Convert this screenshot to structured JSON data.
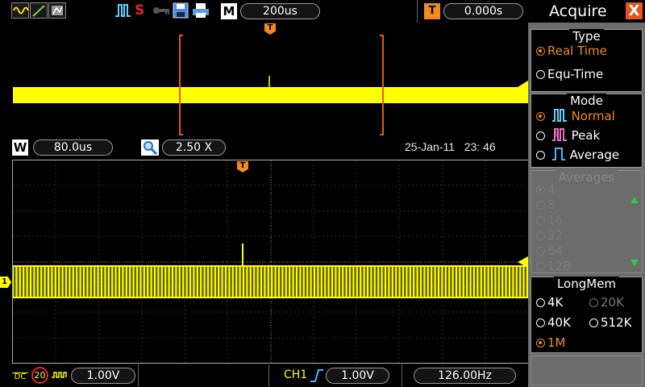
{
  "topbar": {
    "timebase": "200us",
    "trigger_offset": "0.000s",
    "mode_letter": "M",
    "trigger_letter": "T"
  },
  "info": {
    "window_letter": "W",
    "window_scale": "80.0us",
    "zoom_value": "2.50  X",
    "date": "25-Jan-11",
    "time": "23: 46"
  },
  "bottom": {
    "coupling": "DC",
    "bw_limit": "20",
    "ch_scale": "1.00V",
    "trig_source": "CH1",
    "trig_level": "1.00V",
    "frequency": "126.00Hz"
  },
  "channel_marker": "1",
  "marker_T": "T",
  "panel": {
    "title": "Acquire",
    "close": "X",
    "type": {
      "title": "Type",
      "options": [
        "Real  Time",
        "Equ-Time"
      ]
    },
    "mode": {
      "title": "Mode",
      "options": [
        "Normal",
        "Peak",
        "Average"
      ]
    },
    "averages": {
      "title": "Averages",
      "options": [
        "4",
        "8",
        "16",
        "32",
        "64",
        "128"
      ]
    },
    "longmem": {
      "title": "LongMem",
      "options": [
        "4K",
        "20K",
        "40K",
        "512K",
        "1M"
      ]
    }
  },
  "colors": {
    "trace": "#ffff00",
    "accent": "#f08c1e",
    "panel_bg": "#6c6c6c"
  }
}
